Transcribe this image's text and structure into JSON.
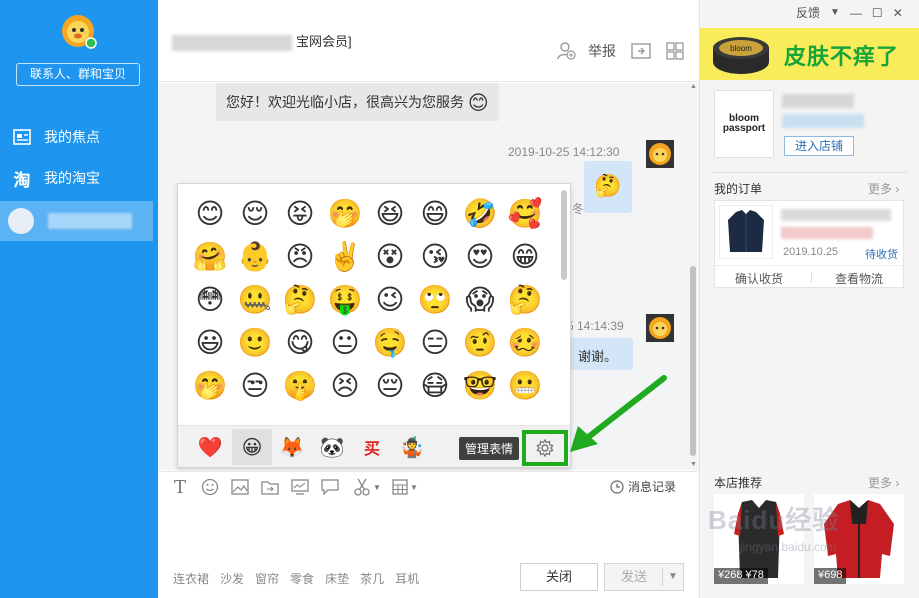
{
  "sidebar": {
    "search_placeholder": "联系人、群和宝贝",
    "items": [
      {
        "label": "我的焦点",
        "icon": "focus-icon"
      },
      {
        "label": "我的淘宝",
        "icon": "taobao-icon"
      }
    ],
    "active_contact_label": ""
  },
  "header": {
    "title_suffix": "宝网会员]",
    "report_label": "举报"
  },
  "messages": {
    "greeting": "您好！欢迎光临小店，很高兴为您服务",
    "timestamp_1": "2019-10-25 14:12:30",
    "timestamp_2": "5 14:14:39",
    "partial_text": "，谢谢。",
    "partial_text_2": "冬"
  },
  "emoji_panel": {
    "rows": [
      [
        "😊",
        "😌",
        "😝",
        "🤭",
        "😆",
        "😄",
        "🤣",
        "🥰"
      ],
      [
        "🤗",
        "👶",
        "😠",
        "✌️",
        "😵",
        "😘",
        "😍",
        "😁"
      ],
      [
        "😳",
        "🤐",
        "🤔",
        "🤑",
        "😉",
        "🙄",
        "😱",
        "🤔"
      ],
      [
        "😃",
        "🙂",
        "😋",
        "😐",
        "🤤",
        "😑",
        "🤨",
        "🥴"
      ],
      [
        "🤭",
        "😒",
        "🤫",
        "😣",
        "😔",
        "😷",
        "🤓",
        "😬"
      ]
    ],
    "tabs": [
      "❤️",
      "😀",
      "🦊",
      "🐼",
      "买",
      "🤹"
    ],
    "manage_tooltip": "管理表情"
  },
  "toolbar": {
    "history_label": "消息记录"
  },
  "input": {
    "quick_words": [
      "连衣裙",
      "沙发",
      "窗帘",
      "零食",
      "床垫",
      "茶几",
      "耳机"
    ],
    "close_label": "关闭",
    "send_label": "发送"
  },
  "right_panel": {
    "feedback_label": "反馈",
    "ad_text": "皮肤不痒了",
    "shop_logo_line1": "bloom",
    "shop_logo_line2": "passport",
    "enter_shop_label": "进入店铺",
    "orders_title": "我的订单",
    "more_label": "更多",
    "order_date": "2019.10.25",
    "order_status": "待收货",
    "confirm_receipt_label": "确认收货",
    "view_logistics_label": "查看物流",
    "recommend_title": "本店推荐",
    "rec_prices": [
      "¥268 ¥78",
      "¥698"
    ]
  },
  "watermark": {
    "text": "Baidu经验",
    "sub": "jingyan.baidu.com"
  }
}
